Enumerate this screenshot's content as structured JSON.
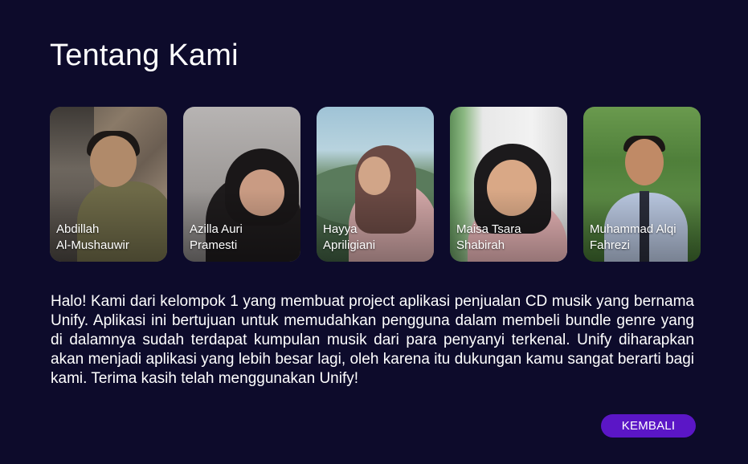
{
  "page": {
    "title": "Tentang Kami"
  },
  "team": [
    {
      "first": "Abdillah",
      "second": "Al-Mushauwir"
    },
    {
      "first": "Azilla Auri",
      "second": "Pramesti"
    },
    {
      "first": "Hayya",
      "second": "Apriligiani"
    },
    {
      "first": "Maisa Tsara",
      "second": "Shabirah"
    },
    {
      "first": "Muhammad Alqi",
      "second": "Fahrezi"
    }
  ],
  "about": {
    "text": "Halo! Kami dari kelompok 1 yang membuat project aplikasi penjualan CD musik yang bernama Unify. Aplikasi ini bertujuan untuk memudahkan pengguna dalam membeli bundle genre yang di dalamnya sudah terdapat kumpulan musik dari para penyanyi terkenal. Unify diharapkan akan menjadi aplikasi yang lebih besar lagi, oleh karena itu dukungan kamu sangat berarti bagi kami. Terima kasih telah menggunakan Unify!"
  },
  "actions": {
    "back_label": "KEMBALI"
  },
  "colors": {
    "background": "#0d0b2b",
    "button": "#5b16c6",
    "text": "#ffffff"
  }
}
